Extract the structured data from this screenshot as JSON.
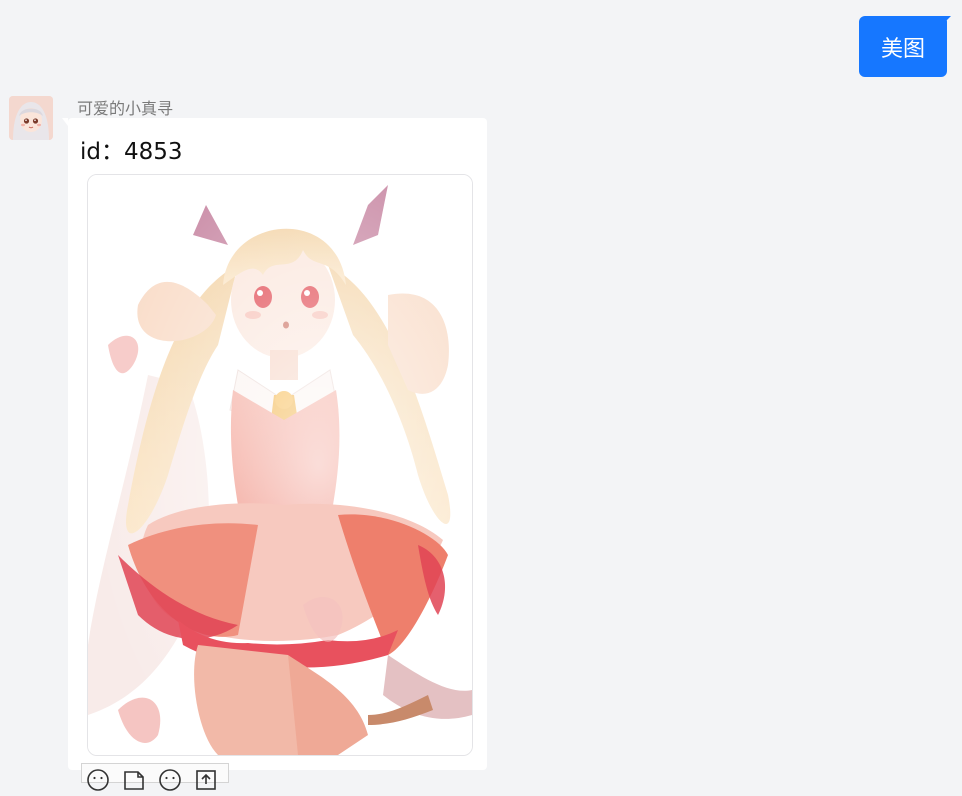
{
  "user_message": {
    "text": "美图"
  },
  "bot": {
    "name": "可爱的小真寻",
    "id_label": "id：",
    "id_value": "4853"
  },
  "colors": {
    "accent": "#1677ff",
    "background": "#f3f4f6",
    "card": "#ffffff"
  },
  "actions": [
    {
      "icon": "smile-icon"
    },
    {
      "icon": "sticker-icon"
    },
    {
      "icon": "emoji-icon"
    },
    {
      "icon": "share-icon"
    }
  ]
}
